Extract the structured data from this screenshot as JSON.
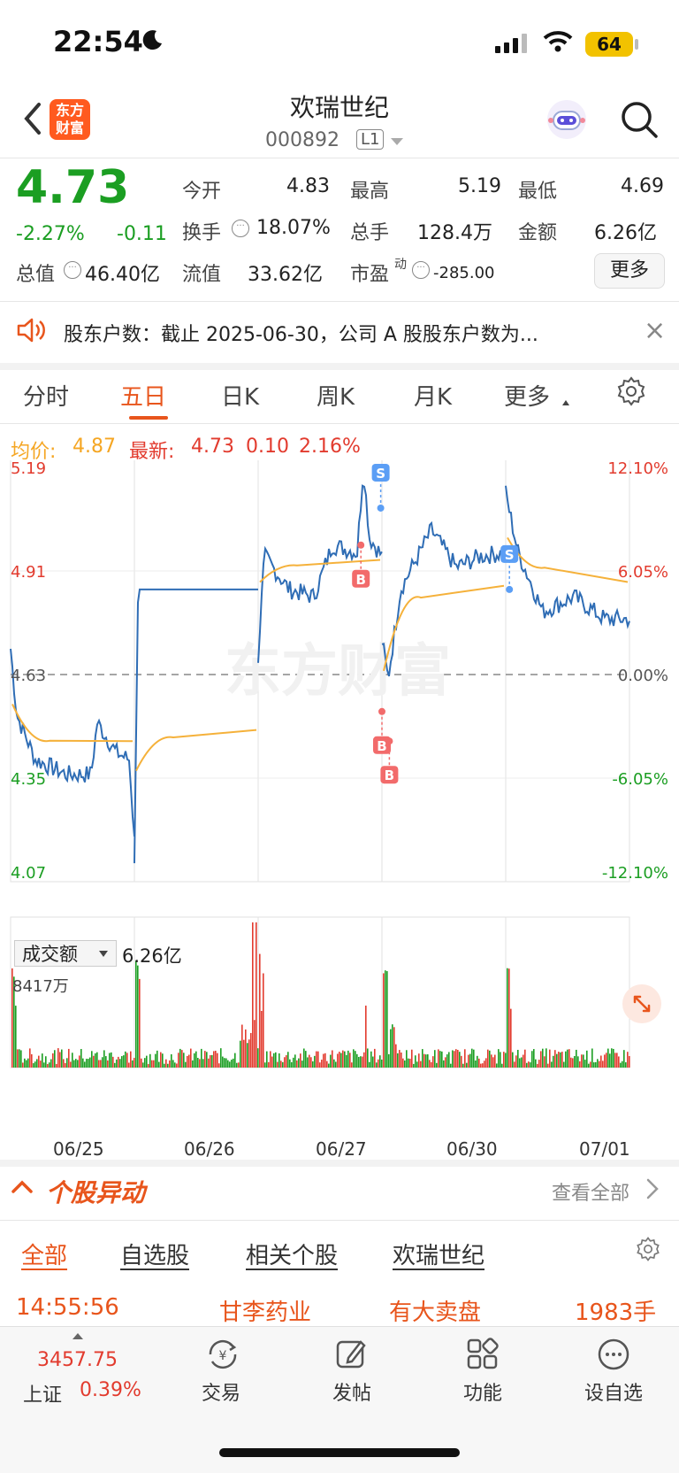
{
  "status": {
    "time": "22:54",
    "battery": "64"
  },
  "header": {
    "name": "欢瑞世纪",
    "code": "000892",
    "level": "L1",
    "logo_text": "东方财富"
  },
  "quote": {
    "price": "4.73",
    "pct": "-2.27%",
    "chg": "-0.11",
    "open_label": "今开",
    "open": "4.83",
    "high_label": "最高",
    "high": "5.19",
    "low_label": "最低",
    "low": "4.69",
    "turnover_label": "换手",
    "turnover": "18.07%",
    "volume_label": "总手",
    "volume": "128.4万",
    "amount_label": "金额",
    "amount": "6.26亿",
    "mktcap_label": "总值",
    "mktcap": "46.40亿",
    "float_label": "流值",
    "float": "33.62亿",
    "pe_label": "市盈",
    "pe_sup": "动",
    "pe": "-285.00",
    "more": "更多"
  },
  "notice": {
    "text": "股东户数：截止 2025-06-30，公司 A 股股东户数为..."
  },
  "tabs": [
    "分时",
    "五日",
    "日K",
    "周K",
    "月K",
    "更多"
  ],
  "active_tab": "五日",
  "legend": {
    "avg_label": "均价:",
    "avg": "4.87",
    "latest_label": "最新:",
    "latest": "4.73",
    "change": "0.10",
    "change_pct": "2.16%"
  },
  "chart_data": {
    "type": "line",
    "title": "",
    "x_labels": [
      "06/25",
      "06/26",
      "06/27",
      "06/30",
      "07/01"
    ],
    "y_left": [
      "5.19",
      "4.91",
      "4.63",
      "4.35",
      "4.07"
    ],
    "y_right": [
      "12.10%",
      "6.05%",
      "0.00%",
      "-6.05%",
      "-12.10%"
    ],
    "ylim": [
      4.07,
      5.19
    ],
    "prev_close": 4.63,
    "watermark": "东方财富",
    "series": [
      {
        "name": "最新",
        "color": "#2f6db5"
      },
      {
        "name": "均价",
        "color": "#f5b13a"
      }
    ],
    "trade_markers": [
      {
        "label": "B",
        "day": "06/27",
        "price": 4.98
      },
      {
        "label": "S",
        "day": "06/27",
        "price": 5.08
      },
      {
        "label": "B",
        "day": "06/30",
        "price": 4.53
      },
      {
        "label": "B",
        "day": "06/30",
        "price": 4.45
      },
      {
        "label": "S",
        "day": "07/01",
        "price": 4.86
      }
    ],
    "volume": {
      "selector": "成交额",
      "total": "6.26亿",
      "max_label": "8417万"
    }
  },
  "section": {
    "title": "个股异动",
    "view_all": "查看全部"
  },
  "filter_tabs": [
    "全部",
    "自选股",
    "相关个股",
    "欢瑞世纪"
  ],
  "alert_row": {
    "time": "14:55:56",
    "stock": "甘李药业",
    "type": "有大卖盘",
    "qty": "1983手"
  },
  "bottom": {
    "index_value": "3457.75",
    "index_name": "上证",
    "index_pct": "0.39%",
    "items": [
      "交易",
      "发帖",
      "功能",
      "设自选"
    ]
  }
}
